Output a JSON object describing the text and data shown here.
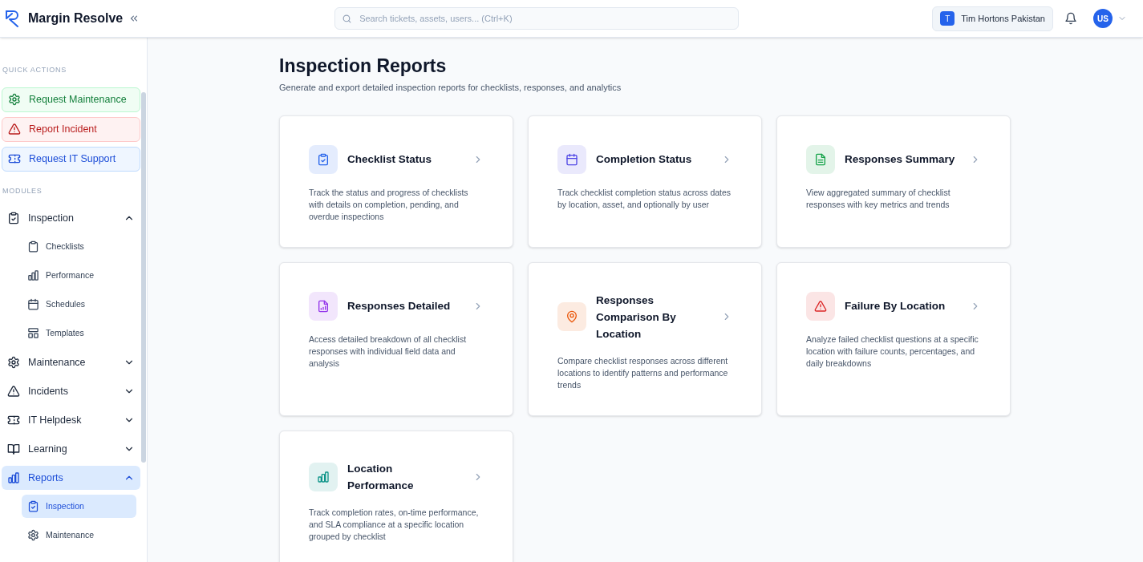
{
  "app": {
    "name": "Margin Resolve"
  },
  "search": {
    "placeholder": "Search tickets, assets, users... (Ctrl+K)"
  },
  "organization": {
    "initial": "T",
    "name": "Tim Hortons Pakistan"
  },
  "user": {
    "initials": "US"
  },
  "sidebar": {
    "quick_actions_heading": "QUICK ACTIONS",
    "quick_actions": [
      {
        "kind": "maintenance",
        "label": "Request Maintenance"
      },
      {
        "kind": "incident",
        "label": "Report Incident"
      },
      {
        "kind": "support",
        "label": "Request IT Support"
      }
    ],
    "modules_heading": "MODULES",
    "modules": [
      {
        "kind": "clipboard",
        "label": "Inspection",
        "expanded": true,
        "selected": false,
        "children": [
          {
            "kind": "clipboard-plain",
            "label": "Checklists",
            "selected": false
          },
          {
            "kind": "bars",
            "label": "Performance",
            "selected": false
          },
          {
            "kind": "calendar",
            "label": "Schedules",
            "selected": false
          },
          {
            "kind": "layout",
            "label": "Templates",
            "selected": false
          }
        ]
      },
      {
        "kind": "gear",
        "label": "Maintenance",
        "expanded": false,
        "selected": false
      },
      {
        "kind": "alert",
        "label": "Incidents",
        "expanded": false,
        "selected": false
      },
      {
        "kind": "ticket",
        "label": "IT Helpdesk",
        "expanded": false,
        "selected": false
      },
      {
        "kind": "book",
        "label": "Learning",
        "expanded": false,
        "selected": false
      },
      {
        "kind": "bars",
        "label": "Reports",
        "expanded": true,
        "selected": true,
        "children": [
          {
            "kind": "clipboard",
            "label": "Inspection",
            "selected": true
          },
          {
            "kind": "gear",
            "label": "Maintenance",
            "selected": false
          }
        ]
      }
    ]
  },
  "page": {
    "title": "Inspection Reports",
    "subtitle": "Generate and export detailed inspection reports for checklists, responses, and analytics"
  },
  "reports": [
    {
      "kind": "clipboard",
      "color": "#2563eb",
      "title": "Checklist Status",
      "description": "Track the status and progress of checklists with details on completion, pending, and overdue inspections"
    },
    {
      "kind": "calendar",
      "color": "#4f46e5",
      "title": "Completion Status",
      "description": "Track checklist completion status across dates by location, asset, and optionally by user"
    },
    {
      "kind": "file",
      "color": "#16a34a",
      "title": "Responses Summary",
      "description": "View aggregated summary of checklist responses with key metrics and trends"
    },
    {
      "kind": "chart-file",
      "color": "#9333ea",
      "title": "Responses Detailed",
      "description": "Access detailed breakdown of all checklist responses with individual field data and analysis"
    },
    {
      "kind": "pin",
      "color": "#ea580c",
      "title": "Responses Comparison By Location",
      "description": "Compare checklist responses across different locations to identify patterns and performance trends"
    },
    {
      "kind": "alert",
      "color": "#dc2626",
      "title": "Failure By Location",
      "description": "Analyze failed checklist questions at a specific location with failure counts, percentages, and daily breakdowns"
    },
    {
      "kind": "bars",
      "color": "#0d9488",
      "title": "Location Performance",
      "description": "Track completion rates, on-time performance, and SLA compliance at a specific location grouped by checklist"
    }
  ]
}
